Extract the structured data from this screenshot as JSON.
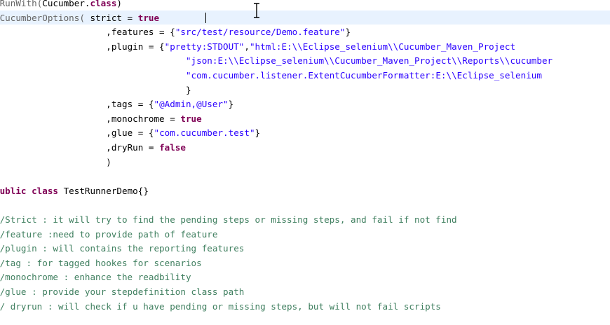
{
  "editor": {
    "cursor_icon": "text-ibeam-cursor-icon",
    "colors": {
      "annotation": "#646464",
      "keyword": "#7f0055",
      "string": "#2a00ff",
      "comment": "#3f7f5f",
      "plain": "#000000",
      "current_line": "#e8f2fe"
    },
    "lines": [
      {
        "indent": "",
        "tokens": [
          {
            "t": "@RunWith(",
            "c": "ann"
          },
          {
            "t": "Cucumber.",
            "c": "plain"
          },
          {
            "t": "class",
            "c": "kw"
          },
          {
            "t": ")",
            "c": "plain"
          }
        ]
      },
      {
        "indent": "",
        "tokens": [
          {
            "t": "@CucumberOptions( ",
            "c": "ann"
          },
          {
            "t": "strict = ",
            "c": "plain"
          },
          {
            "t": "true",
            "c": "kw"
          }
        ]
      },
      {
        "indent": "                     ",
        "tokens": [
          {
            "t": ",features = {",
            "c": "plain"
          },
          {
            "t": "\"src/test/resource/Demo.feature\"",
            "c": "str"
          },
          {
            "t": "}",
            "c": "plain"
          }
        ]
      },
      {
        "indent": "                     ",
        "tokens": [
          {
            "t": ",plugin = {",
            "c": "plain"
          },
          {
            "t": "\"pretty:STDOUT\"",
            "c": "str"
          },
          {
            "t": ",",
            "c": "plain"
          },
          {
            "t": "\"html:E:\\\\Eclipse_selenium\\\\Cucumber_Maven_Project",
            "c": "str"
          }
        ]
      },
      {
        "indent": "                                    ",
        "tokens": [
          {
            "t": "\"json:E:\\\\Eclipse_selenium\\\\Cucumber_Maven_Project\\\\Reports\\\\cucumber",
            "c": "str"
          }
        ]
      },
      {
        "indent": "                                    ",
        "tokens": [
          {
            "t": "\"com.cucumber.listener.ExtentCucumberFormatter:E:\\\\Eclipse_selenium",
            "c": "str"
          }
        ]
      },
      {
        "indent": "                                    ",
        "tokens": [
          {
            "t": "}",
            "c": "plain"
          }
        ]
      },
      {
        "indent": "                     ",
        "tokens": [
          {
            "t": ",tags = {",
            "c": "plain"
          },
          {
            "t": "\"@Admin,@User\"",
            "c": "str"
          },
          {
            "t": "}",
            "c": "plain"
          }
        ]
      },
      {
        "indent": "                     ",
        "tokens": [
          {
            "t": ",monochrome = ",
            "c": "plain"
          },
          {
            "t": "true",
            "c": "kw"
          }
        ]
      },
      {
        "indent": "                     ",
        "tokens": [
          {
            "t": ",glue = {",
            "c": "plain"
          },
          {
            "t": "\"com.cucumber.test\"",
            "c": "str"
          },
          {
            "t": "}",
            "c": "plain"
          }
        ]
      },
      {
        "indent": "                     ",
        "tokens": [
          {
            "t": ",dryRun = ",
            "c": "plain"
          },
          {
            "t": "false",
            "c": "kw"
          }
        ]
      },
      {
        "indent": "                     ",
        "tokens": [
          {
            "t": ")",
            "c": "plain"
          }
        ]
      },
      {
        "indent": "",
        "tokens": []
      },
      {
        "indent": "",
        "tokens": [
          {
            "t": "public",
            "c": "kw"
          },
          {
            "t": " ",
            "c": "plain"
          },
          {
            "t": "class",
            "c": "kw"
          },
          {
            "t": " TestRunnerDemo{}",
            "c": "plain"
          }
        ]
      },
      {
        "indent": "",
        "tokens": []
      },
      {
        "indent": "",
        "tokens": [
          {
            "t": "//Strict : it will try to find the pending steps or missing steps, and fail if not find",
            "c": "cmt"
          }
        ]
      },
      {
        "indent": "",
        "tokens": [
          {
            "t": "//feature :need to provide path of feature",
            "c": "cmt"
          }
        ]
      },
      {
        "indent": "",
        "tokens": [
          {
            "t": "//plugin : will contains the reporting features",
            "c": "cmt"
          }
        ]
      },
      {
        "indent": "",
        "tokens": [
          {
            "t": "//tag : for tagged hookes for scenarios",
            "c": "cmt"
          }
        ]
      },
      {
        "indent": "",
        "tokens": [
          {
            "t": "//monochrome : enhance the readbility",
            "c": "cmt"
          }
        ]
      },
      {
        "indent": "",
        "tokens": [
          {
            "t": "//glue : provide your stepdefinition class path",
            "c": "cmt"
          }
        ]
      },
      {
        "indent": "",
        "tokens": [
          {
            "t": "// dryrun : will check if u have pending or missing steps, but will not fail scripts",
            "c": "cmt"
          }
        ]
      }
    ]
  }
}
